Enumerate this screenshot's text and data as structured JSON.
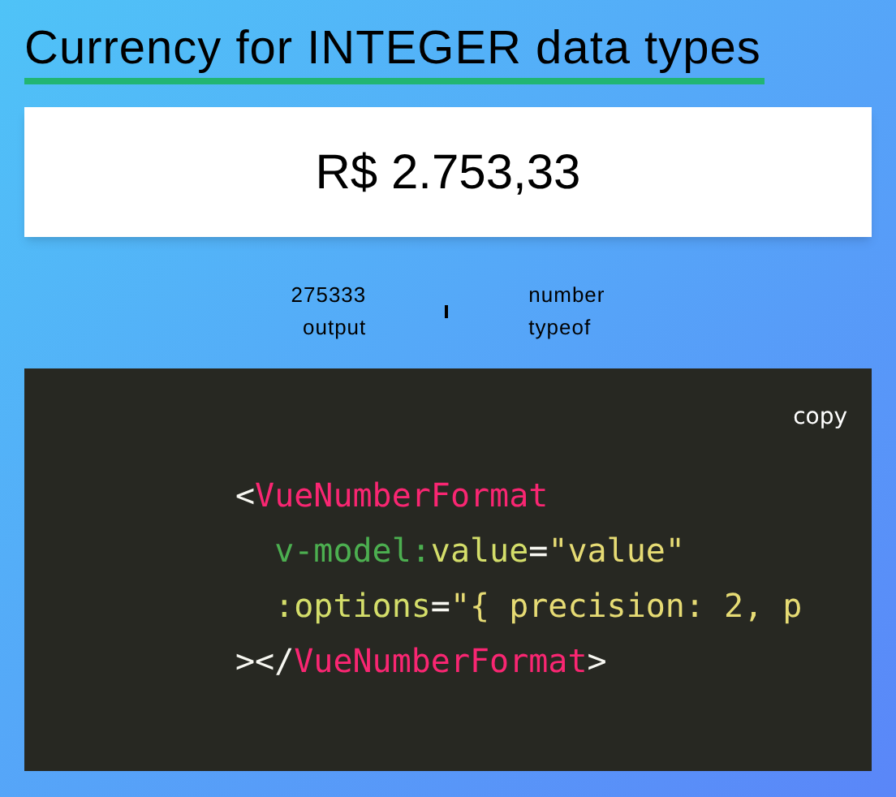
{
  "title": "Currency for INTEGER data types",
  "display": {
    "value": "R$ 2.753,33"
  },
  "stats": [
    {
      "value": "275333",
      "label": "output"
    },
    {
      "value": "number",
      "label": "typeof"
    }
  ],
  "code": {
    "copy": "copy",
    "lines": [
      {
        "tokens": [
          {
            "kind": "punct",
            "text": "<"
          },
          {
            "kind": "tag",
            "text": "VueNumberFormat"
          }
        ]
      },
      {
        "tokens": [
          {
            "kind": "directive",
            "text": "  v-model:"
          },
          {
            "kind": "attr",
            "text": "value"
          },
          {
            "kind": "punct",
            "text": "="
          },
          {
            "kind": "string",
            "text": "\"value\""
          }
        ]
      },
      {
        "tokens": [
          {
            "kind": "attr",
            "text": "  :options"
          },
          {
            "kind": "punct",
            "text": "="
          },
          {
            "kind": "string",
            "text": "\"{ precision: 2, p"
          }
        ]
      },
      {
        "tokens": [
          {
            "kind": "punct",
            "text": "></"
          },
          {
            "kind": "tag",
            "text": "VueNumberFormat"
          },
          {
            "kind": "punct",
            "text": ">"
          }
        ]
      }
    ]
  }
}
